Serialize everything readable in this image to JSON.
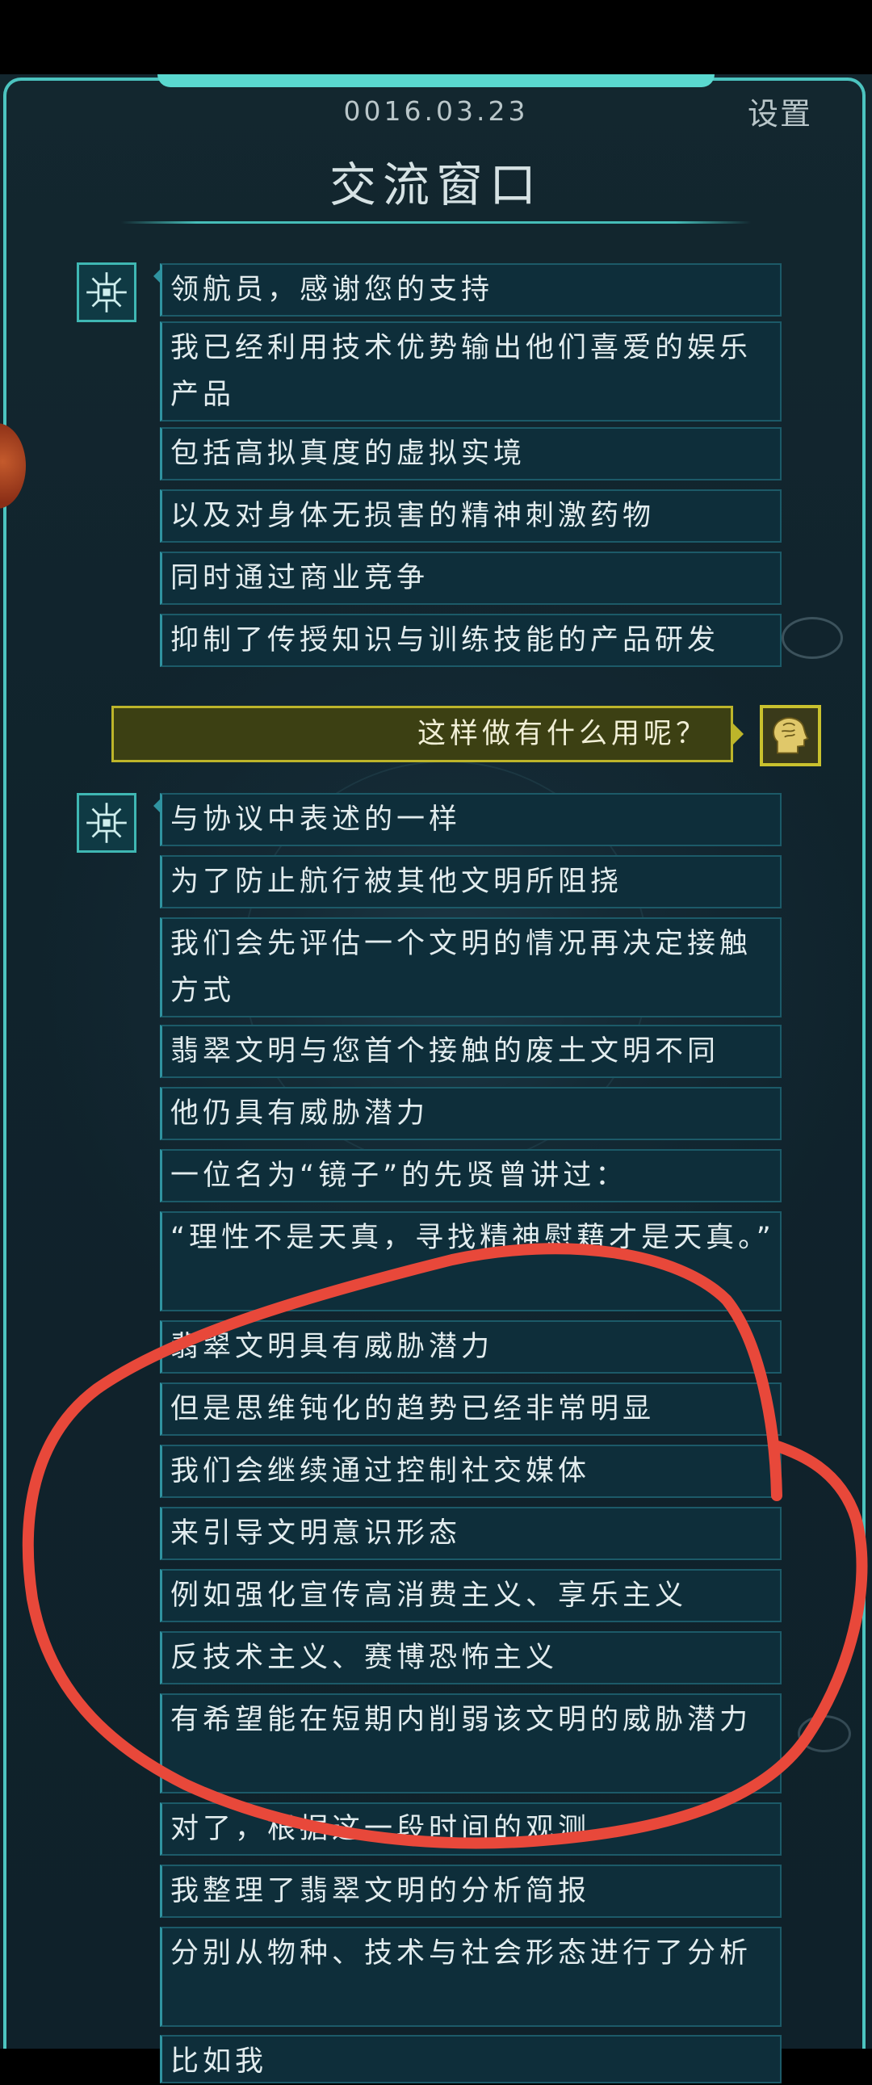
{
  "header": {
    "date": "0016.03.23",
    "settings_label": "设置",
    "title": "交流窗口"
  },
  "messages_group1": [
    "领航员，感谢您的支持",
    "我已经利用技术优势输出他们喜爱的娱乐产品",
    "包括高拟真度的虚拟实境",
    "以及对身体无损害的精神刺激药物",
    "同时通过商业竞争",
    "抑制了传授知识与训练技能的产品研发"
  ],
  "user_reply": "这样做有什么用呢？",
  "messages_group2": [
    "与协议中表述的一样",
    "为了防止航行被其他文明所阻挠",
    "我们会先评估一个文明的情况再决定接触方式",
    "翡翠文明与您首个接触的废土文明不同",
    "他仍具有威胁潜力",
    "一位名为“镜子”的先贤曾讲过：",
    "“理性不是天真，寻找精神慰藉才是天真。”",
    "翡翠文明具有威胁潜力",
    "但是思维钝化的趋势已经非常明显",
    "我们会继续通过控制社交媒体",
    "来引导文明意识形态",
    "例如强化宣传高消费主义、享乐主义",
    "反技术主义、赛博恐怖主义",
    "有希望能在短期内削弱该文明的威胁潜力",
    "对了，根据这一段时间的观测",
    "我整理了翡翠文明的分析简报",
    "分别从物种、技术与社会形态进行了分析",
    "比如我"
  ],
  "icons": {
    "ai_avatar": "circuit-chip-icon",
    "user_avatar": "brain-head-icon"
  },
  "colors": {
    "panel_border": "#4cc4c0",
    "ai_bubble": "#0e2e3a",
    "user_bubble": "#3c4013",
    "user_border": "#bdb52a",
    "annotation": "#e8483a"
  }
}
